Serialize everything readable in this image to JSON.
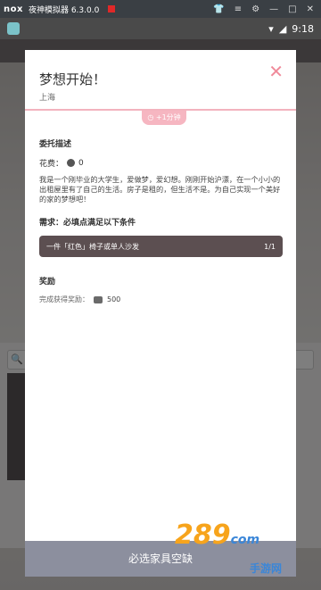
{
  "emulator": {
    "logo": "nox",
    "title": "夜神模拟器 6.3.0.0",
    "icons": [
      "shirt-icon",
      "menu-icon",
      "settings-icon",
      "minimize-icon",
      "maximize-icon",
      "close-icon"
    ]
  },
  "status": {
    "time": "9:18"
  },
  "modal": {
    "title": "梦想开始！",
    "location": "上海",
    "time_badge": "+1分钟",
    "section_desc": "委托描述",
    "cost_label": "花费：",
    "cost_value": "0",
    "description": "我是一个刚毕业的大学生，爱做梦，爱幻想。刚刚开始沪漂，在一个小小的出租屋里有了自己的生活。房子是租的，但生活不是。为自己实现一个美好的家的梦想吧！",
    "section_req": "需求：必填点满足以下条件",
    "requirement": "一件「红色」椅子或单人沙发",
    "requirement_count": "1/1",
    "section_reward": "奖励",
    "reward_label": "完成获得奖励：",
    "reward_value": "500",
    "bottom_button": "必选家具空缺"
  },
  "watermark": {
    "brand": "289",
    "suffix": "com",
    "sub": "手游网"
  }
}
